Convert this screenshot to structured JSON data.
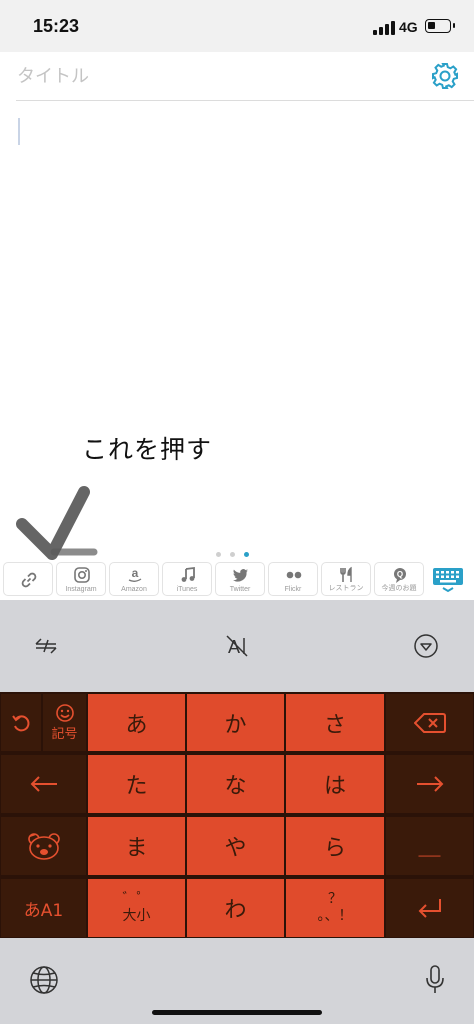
{
  "status_bar": {
    "time": "15:23",
    "network": "4G",
    "signal_icon": "signal-bars-icon",
    "battery_icon": "battery-icon",
    "battery_level": 0.25
  },
  "editor": {
    "title_placeholder": "タイトル",
    "title_value": "",
    "body_value": "",
    "settings_icon": "gear-icon"
  },
  "annotation": {
    "text": "これを押す",
    "mark_icon": "handwritten-check-mark"
  },
  "pager": {
    "pages": 3,
    "current": 3
  },
  "toolbar": {
    "items": [
      {
        "icon": "link-icon",
        "label": ""
      },
      {
        "icon": "instagram-icon",
        "label": "Instagram"
      },
      {
        "icon": "amazon-icon",
        "label": "Amazon"
      },
      {
        "icon": "music-note-icon",
        "label": "iTunes"
      },
      {
        "icon": "twitter-icon",
        "label": "Twitter"
      },
      {
        "icon": "flickr-icon",
        "label": "Flickr"
      },
      {
        "icon": "fork-knife-icon",
        "label": "レストラン"
      },
      {
        "icon": "speech-bubble-icon",
        "label": "今週のお題"
      }
    ],
    "keyboard_icon": "keyboard-icon",
    "accent": "#2aa0c8"
  },
  "keyboard": {
    "top_tools": {
      "left_icon": "cursor-arrows-icon",
      "center_label": "A",
      "right_icon": "chevron-down-circle-icon"
    },
    "keys": {
      "undo_icon": "undo-icon",
      "symbols_label": "記号",
      "symbols_icon": "smiley-icon",
      "a": "あ",
      "ka": "か",
      "sa": "さ",
      "delete_icon": "backspace-icon",
      "left_icon": "arrow-left-icon",
      "ta": "た",
      "na": "な",
      "ha": "は",
      "right_icon": "arrow-right-icon",
      "bear_icon": "bear-face-icon",
      "ma": "ま",
      "ya": "や",
      "ra": "ら",
      "space_label": "＿",
      "mode_label": "あA1",
      "dakuten_top": "゛゜",
      "dakuten_bottom": "大小",
      "wa": "わ",
      "punct_top": "？",
      "punct_bottom": "。、！",
      "enter_icon": "return-icon"
    },
    "bottom": {
      "globe_icon": "globe-icon",
      "mic_icon": "microphone-icon"
    },
    "colors": {
      "dark_key": "#3a1a0a",
      "orange_key": "#e04b2c"
    }
  }
}
